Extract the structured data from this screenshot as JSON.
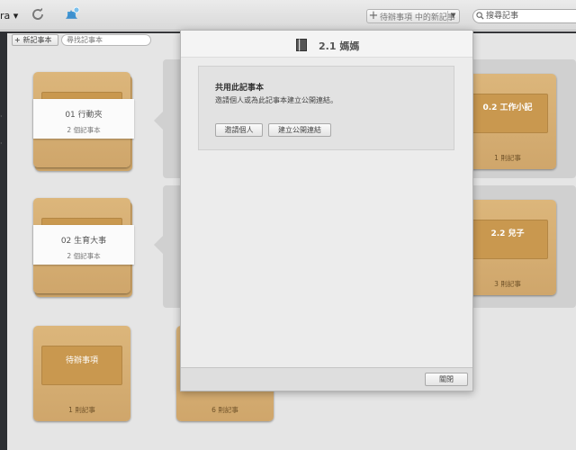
{
  "toolbar": {
    "account_name": "ra ▾",
    "new_note_label": "待辦事項 中的新記事",
    "search_placeholder": "搜尋記事"
  },
  "subtoolbar": {
    "new_notebook_label": "新記事本",
    "find_notebook_placeholder": "尋找記事本"
  },
  "notebooks": [
    {
      "title": "01 行動夾",
      "count": "2 個記事本",
      "kind": "stack-selected"
    },
    {
      "title": "02 生育大事",
      "count": "2 個記事本",
      "kind": "stack-selected"
    },
    {
      "title": "待辦事項",
      "count": "1 則記事",
      "kind": "notebook"
    },
    {
      "title": "",
      "count": "6 則記事",
      "kind": "notebook"
    },
    {
      "title": "0.2 工作小記",
      "count": "1 則記事",
      "kind": "notebook"
    },
    {
      "title": "2.2 兒子",
      "count": "3 則記事",
      "kind": "notebook"
    }
  ],
  "popover": {
    "title": "2.1 媽媽",
    "share_heading": "共用此記事本",
    "share_desc": "邀請個人或為此記事本建立公開連結。",
    "invite_label": "邀請個人",
    "public_link_label": "建立公開連結",
    "close_label": "關閉"
  },
  "colors": {
    "notebook_cover": "#d6af73",
    "notebook_label": "#c9984f",
    "sidebar": "#2d2f33",
    "stack_group": "#d0d0d0"
  }
}
